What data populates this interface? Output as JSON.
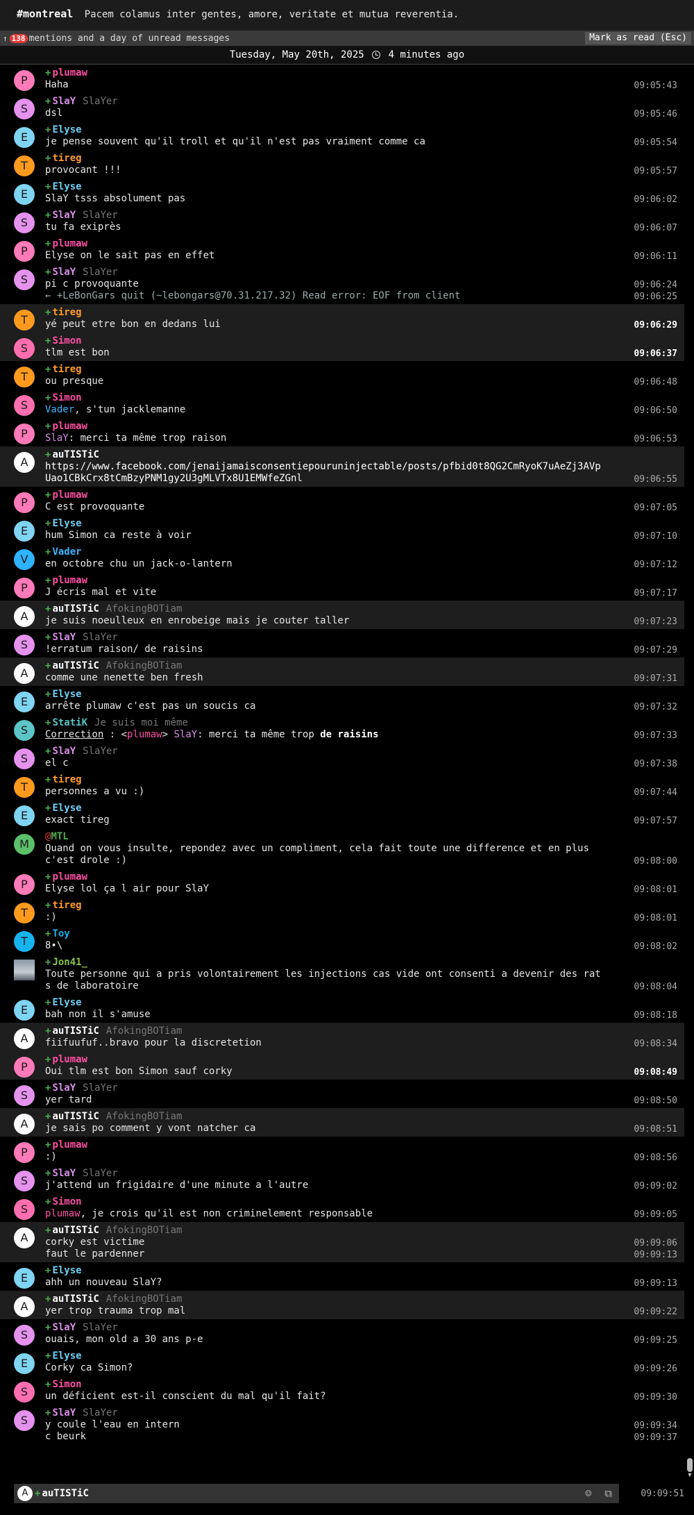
{
  "topic": {
    "channel": "#montreal",
    "text": "Pacem colamus inter gentes, amore, veritate et mutua reverentia."
  },
  "unread": {
    "arrow": "↑",
    "count": "138",
    "text": "mentions and a day of unread messages",
    "mark_label": "Mark as read (Esc)"
  },
  "day": {
    "date": "Tuesday, May 20th, 2025",
    "ago": "4 minutes ago"
  },
  "colors": {
    "plumaw": "#ff4fa3",
    "slay": "#d98ee8",
    "elyse": "#6fd0f5",
    "tireg": "#ff9c2a",
    "simon": "#ff4fa3",
    "vader": "#3ab6ff",
    "autistic": "#ffffff",
    "statik": "#55c2c2",
    "mtl": "#4caf50",
    "toy": "#16b4ef",
    "jon": "#8bc34a"
  },
  "messages": [
    {
      "nick": "plumaw",
      "avatar": "P",
      "bg": "#ff7ab8",
      "color": "plumaw",
      "text": "Haha",
      "ts": "09:05:43"
    },
    {
      "nick": "SlaY",
      "real": "SlaYer",
      "avatar": "S",
      "bg": "#e592ef",
      "color": "slay",
      "text": "dsl",
      "ts": "09:05:46"
    },
    {
      "nick": "Elyse",
      "avatar": "E",
      "bg": "#7fd4f2",
      "color": "elyse",
      "text": "je pense souvent qu'il troll et qu'il n'est pas vraiment comme ca",
      "ts": "09:05:54"
    },
    {
      "nick": "tireg",
      "avatar": "T",
      "bg": "#ff9a1f",
      "color": "tireg",
      "text": "provocant !!!",
      "ts": "09:05:57"
    },
    {
      "nick": "Elyse",
      "avatar": "E",
      "bg": "#7fd4f2",
      "color": "elyse",
      "text": "SlaY tsss absolument pas",
      "ts": "09:06:02"
    },
    {
      "nick": "SlaY",
      "real": "SlaYer",
      "avatar": "S",
      "bg": "#e592ef",
      "color": "slay",
      "text": "tu fa exiprès",
      "ts": "09:06:07"
    },
    {
      "nick": "plumaw",
      "avatar": "P",
      "bg": "#ff7ab8",
      "color": "plumaw",
      "text": "Elyse on le sait pas en effet",
      "ts": "09:06:11"
    },
    {
      "nick": "SlaY",
      "real": "SlaYer",
      "avatar": "S",
      "bg": "#e592ef",
      "color": "slay",
      "text": "pi c provoquante",
      "ts": "09:06:24",
      "sys": "← +LeBonGars quit (~lebongars@70.31.217.32) Read error: EOF from client",
      "sys_ts": "09:06:25"
    },
    {
      "nick": "tireg",
      "avatar": "T",
      "bg": "#ff9a1f",
      "color": "tireg",
      "text": "yé peut etre bon en dedans lui",
      "ts": "09:06:29",
      "hl": true,
      "bold": true
    },
    {
      "nick": "Simon",
      "avatar": "S",
      "bg": "#ff6fb0",
      "color": "simon",
      "text": "tlm est bon",
      "ts": "09:06:37",
      "hl": true,
      "bold": true
    },
    {
      "nick": "tireg",
      "avatar": "T",
      "bg": "#ff9a1f",
      "color": "tireg",
      "text": "ou presque",
      "ts": "09:06:48"
    },
    {
      "nick": "Simon",
      "avatar": "S",
      "bg": "#ff6fb0",
      "color": "simon",
      "prefix": "Vader",
      "prefix_color": "vader",
      "text": ", s'tun jacklemanne",
      "ts": "09:06:50"
    },
    {
      "nick": "plumaw",
      "avatar": "P",
      "bg": "#ff7ab8",
      "color": "plumaw",
      "prefix": "SlaY",
      "prefix_color": "slay",
      "text": ": merci ta même trop raison",
      "ts": "09:06:53"
    },
    {
      "nick": "auTISTiC",
      "avatar": "A",
      "bg": "#ffffff",
      "color": "autistic",
      "text": "https://www.facebook.com/jenaijamaisconsentiepouruninjectable/posts/pfbid0t8QG2CmRyoK7uAeZj3AVpUao1CBkCrx8tCmBzyPNM1gy2U3gMLVTx8U1EMWfeZGnl",
      "ts": "09:06:55",
      "hl": true,
      "link": true
    },
    {
      "nick": "plumaw",
      "avatar": "P",
      "bg": "#ff7ab8",
      "color": "plumaw",
      "text": "C est provoquante",
      "ts": "09:07:05"
    },
    {
      "nick": "Elyse",
      "avatar": "E",
      "bg": "#7fd4f2",
      "color": "elyse",
      "text": "hum Simon ca reste à voir",
      "ts": "09:07:10"
    },
    {
      "nick": "Vader",
      "avatar": "V",
      "bg": "#2fb3ff",
      "color": "vader",
      "text": "en octobre chu un jack-o-lantern",
      "ts": "09:07:12"
    },
    {
      "nick": "plumaw",
      "avatar": "P",
      "bg": "#ff7ab8",
      "color": "plumaw",
      "text": "J écris mal et vite",
      "ts": "09:07:17"
    },
    {
      "nick": "auTISTiC",
      "real": "AfokingBOTiam",
      "avatar": "A",
      "bg": "#ffffff",
      "color": "autistic",
      "text": "je suis noeulleux en enrobeige mais je couter taller",
      "ts": "09:07:23",
      "hl": true
    },
    {
      "nick": "SlaY",
      "real": "SlaYer",
      "avatar": "S",
      "bg": "#e592ef",
      "color": "slay",
      "text": "!erratum raison/ de raisins",
      "ts": "09:07:29"
    },
    {
      "nick": "auTISTiC",
      "real": "AfokingBOTiam",
      "avatar": "A",
      "bg": "#ffffff",
      "color": "autistic",
      "text": "comme une nenette ben fresh",
      "ts": "09:07:31",
      "hl": true
    },
    {
      "nick": "Elyse",
      "avatar": "E",
      "bg": "#7fd4f2",
      "color": "elyse",
      "text": "arrête plumaw c'est pas un soucis ca",
      "ts": "09:07:32"
    },
    {
      "nick": "StatiK",
      "real": "Je suis moi même",
      "avatar": "S",
      "bg": "#5cc6c6",
      "color": "statik",
      "correction": true,
      "ts": "09:07:33"
    },
    {
      "nick": "SlaY",
      "real": "SlaYer",
      "avatar": "S",
      "bg": "#e592ef",
      "color": "slay",
      "text": "el c",
      "ts": "09:07:38"
    },
    {
      "nick": "tireg",
      "avatar": "T",
      "bg": "#ff9a1f",
      "color": "tireg",
      "text": "personnes a vu :)",
      "ts": "09:07:44"
    },
    {
      "nick": "Elyse",
      "avatar": "E",
      "bg": "#7fd4f2",
      "color": "elyse",
      "text": "exact tireg",
      "ts": "09:07:57"
    },
    {
      "nick": "MTL",
      "at": true,
      "avatar": "M",
      "bg": "#5cbf6a",
      "color": "mtl",
      "text": "Quand on vous insulte, repondez avec un compliment, cela fait toute une difference et en plus c'est drole :)",
      "ts": "09:08:00"
    },
    {
      "nick": "plumaw",
      "avatar": "P",
      "bg": "#ff7ab8",
      "color": "plumaw",
      "text": "Elyse lol ça l air pour SlaY",
      "ts": "09:08:01"
    },
    {
      "nick": "tireg",
      "avatar": "T",
      "bg": "#ff9a1f",
      "color": "tireg",
      "text": ":)",
      "ts": "09:08:01"
    },
    {
      "nick": "Toy",
      "avatar": "T",
      "bg": "#16b4ef",
      "color": "toy",
      "text": "8•\\",
      "ts": "09:08:02"
    },
    {
      "nick": "Jon41_",
      "avatar": "",
      "img": true,
      "color": "jon",
      "text": "Toute personne qui a pris volontairement les injections cas vide ont consenti a devenir des rats de laboratoire",
      "ts": "09:08:04"
    },
    {
      "nick": "Elyse",
      "avatar": "E",
      "bg": "#7fd4f2",
      "color": "elyse",
      "text": "bah non il s'amuse",
      "ts": "09:08:18"
    },
    {
      "nick": "auTISTiC",
      "real": "AfokingBOTiam",
      "avatar": "A",
      "bg": "#ffffff",
      "color": "autistic",
      "text": "fiifuufuf..bravo pour la discretetion",
      "ts": "09:08:34",
      "hl": true
    },
    {
      "nick": "plumaw",
      "avatar": "P",
      "bg": "#ff7ab8",
      "color": "plumaw",
      "text": "Oui tlm est bon Simon sauf corky",
      "ts": "09:08:49",
      "hl": true,
      "bold": true
    },
    {
      "nick": "SlaY",
      "real": "SlaYer",
      "avatar": "S",
      "bg": "#e592ef",
      "color": "slay",
      "text": "yer tard",
      "ts": "09:08:50"
    },
    {
      "nick": "auTISTiC",
      "real": "AfokingBOTiam",
      "avatar": "A",
      "bg": "#ffffff",
      "color": "autistic",
      "text": "je sais po comment y vont natcher ca",
      "ts": "09:08:51",
      "hl": true
    },
    {
      "nick": "plumaw",
      "avatar": "P",
      "bg": "#ff7ab8",
      "color": "plumaw",
      "text": ":)",
      "ts": "09:08:56"
    },
    {
      "nick": "SlaY",
      "real": "SlaYer",
      "avatar": "S",
      "bg": "#e592ef",
      "color": "slay",
      "text": "j'attend un frigidaire d'une minute a l'autre",
      "ts": "09:09:02"
    },
    {
      "nick": "Simon",
      "avatar": "S",
      "bg": "#ff6fb0",
      "color": "simon",
      "prefix": "plumaw",
      "prefix_color": "plumaw",
      "text": ", je crois qu'il est non criminelement responsable",
      "ts": "09:09:05"
    },
    {
      "nick": "auTISTiC",
      "real": "AfokingBOTiam",
      "avatar": "A",
      "bg": "#ffffff",
      "color": "autistic",
      "text": "corky est victime",
      "ts": "09:09:06",
      "hl": true,
      "extra": "faut le pardenner",
      "extra_ts": "09:09:13"
    },
    {
      "nick": "Elyse",
      "avatar": "E",
      "bg": "#7fd4f2",
      "color": "elyse",
      "text": "ahh un nouveau SlaY?",
      "ts": "09:09:13"
    },
    {
      "nick": "auTISTiC",
      "real": "AfokingBOTiam",
      "avatar": "A",
      "bg": "#ffffff",
      "color": "autistic",
      "text": "yer trop trauma trop mal",
      "ts": "09:09:22",
      "hl": true
    },
    {
      "nick": "SlaY",
      "real": "SlaYer",
      "avatar": "S",
      "bg": "#e592ef",
      "color": "slay",
      "text": "ouais, mon old a 30 ans p-e",
      "ts": "09:09:25"
    },
    {
      "nick": "Elyse",
      "avatar": "E",
      "bg": "#7fd4f2",
      "color": "elyse",
      "text": "Corky ca Simon?",
      "ts": "09:09:26"
    },
    {
      "nick": "Simon",
      "avatar": "S",
      "bg": "#ff6fb0",
      "color": "simon",
      "text": "un déficient est-il conscient du mal qu'il fait?",
      "ts": "09:09:30"
    },
    {
      "nick": "SlaY",
      "real": "SlaYer",
      "avatar": "S",
      "bg": "#e592ef",
      "color": "slay",
      "text": "y coule l'eau en intern",
      "ts": "09:09:34",
      "extra": "c beurk",
      "extra_ts": "09:09:37"
    }
  ],
  "correction": {
    "label": "Correction",
    "sep": " : ",
    "lt": "<",
    "nick": "plumaw",
    "gt": ">",
    "target": "SlaY",
    "text": ": merci ta même trop ",
    "bold": "de raisins"
  },
  "composer": {
    "avatar": "A",
    "nick": "auTISTiC",
    "emoji_icon": "☺",
    "attach_icon": "⧉",
    "ts": "09:09:51"
  }
}
